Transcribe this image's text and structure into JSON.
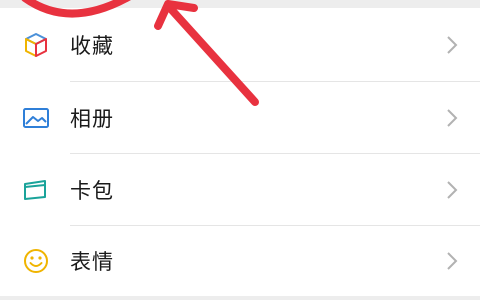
{
  "menu": {
    "items": [
      {
        "label": "收藏",
        "icon": "cube-icon",
        "color": "#4a90d9"
      },
      {
        "label": "相册",
        "icon": "photo-icon",
        "color": "#2f7fd8"
      },
      {
        "label": "卡包",
        "icon": "card-wallet-icon",
        "color": "#1aa39a"
      },
      {
        "label": "表情",
        "icon": "smiley-icon",
        "color": "#f0b400"
      }
    ]
  },
  "annotation": {
    "color": "#e8323f",
    "shapes": [
      "circle-highlight",
      "arrow"
    ]
  }
}
